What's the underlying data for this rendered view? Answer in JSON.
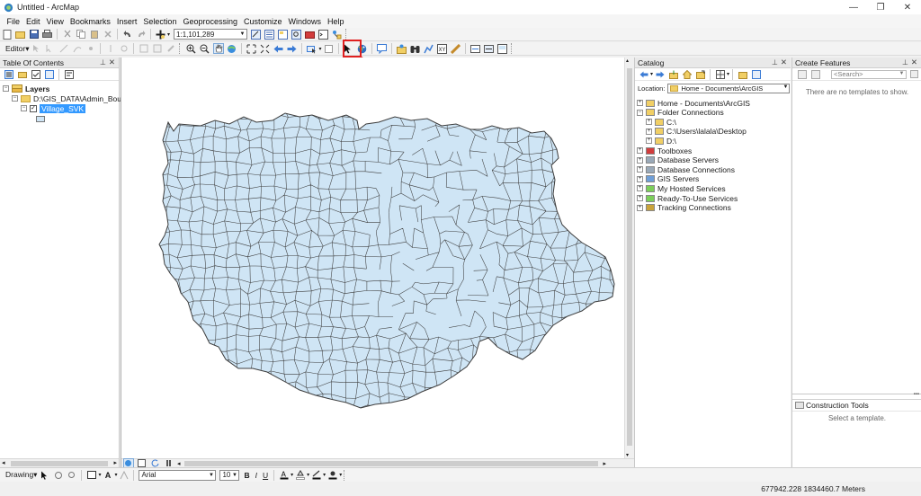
{
  "window": {
    "title": "Untitled - ArcMap",
    "minimize": "—",
    "restore": "❐",
    "close": "✕"
  },
  "menu": [
    "File",
    "Edit",
    "View",
    "Bookmarks",
    "Insert",
    "Selection",
    "Geoprocessing",
    "Customize",
    "Windows",
    "Help"
  ],
  "standard_toolbar": {
    "scale": "1:1,101,289"
  },
  "editor_toolbar": {
    "editor_label": "Editor▾"
  },
  "toc": {
    "title": "Table Of Contents",
    "layers_label": "Layers",
    "data_folder": "D:\\GIS_DATA\\Admin_Bound",
    "layer_name": "Village_SVK",
    "layer_checked": true
  },
  "catalog": {
    "title": "Catalog",
    "location_label": "Location:",
    "location_value": "Home - Documents\\ArcGIS",
    "items": [
      {
        "label": "Home - Documents\\ArcGIS",
        "icon": "home-folder-icon",
        "indent": 0
      },
      {
        "label": "Folder Connections",
        "icon": "folder-connections-icon",
        "indent": 0
      },
      {
        "label": "C:\\",
        "icon": "folder-icon",
        "indent": 1
      },
      {
        "label": "C:\\Users\\lalala\\Desktop",
        "icon": "folder-icon",
        "indent": 1
      },
      {
        "label": "D:\\",
        "icon": "folder-icon",
        "indent": 1
      },
      {
        "label": "Toolboxes",
        "icon": "toolbox-icon",
        "indent": 0
      },
      {
        "label": "Database Servers",
        "icon": "database-server-icon",
        "indent": 0
      },
      {
        "label": "Database Connections",
        "icon": "database-connection-icon",
        "indent": 0
      },
      {
        "label": "GIS Servers",
        "icon": "gis-server-icon",
        "indent": 0
      },
      {
        "label": "My Hosted Services",
        "icon": "hosted-services-icon",
        "indent": 0
      },
      {
        "label": "Ready-To-Use Services",
        "icon": "ready-services-icon",
        "indent": 0
      },
      {
        "label": "Tracking Connections",
        "icon": "tracking-icon",
        "indent": 0
      }
    ]
  },
  "create_features": {
    "title": "Create Features",
    "search_placeholder": "<Search>",
    "empty_message": "There are no templates to show.",
    "construction_title": "Construction Tools",
    "construction_message": "Select a template."
  },
  "drawing_toolbar": {
    "drawing_label": "Drawing▾",
    "font_name": "Arial",
    "font_size": "10",
    "bold": "B",
    "italic": "I",
    "underline": "U"
  },
  "status": {
    "coordinates": "677942.228  1834460.7 Meters"
  },
  "colors": {
    "map_fill": "#cfe5f5",
    "map_stroke": "#3c3c3c",
    "highlight": "#e02020",
    "selection": "#3399ff"
  }
}
